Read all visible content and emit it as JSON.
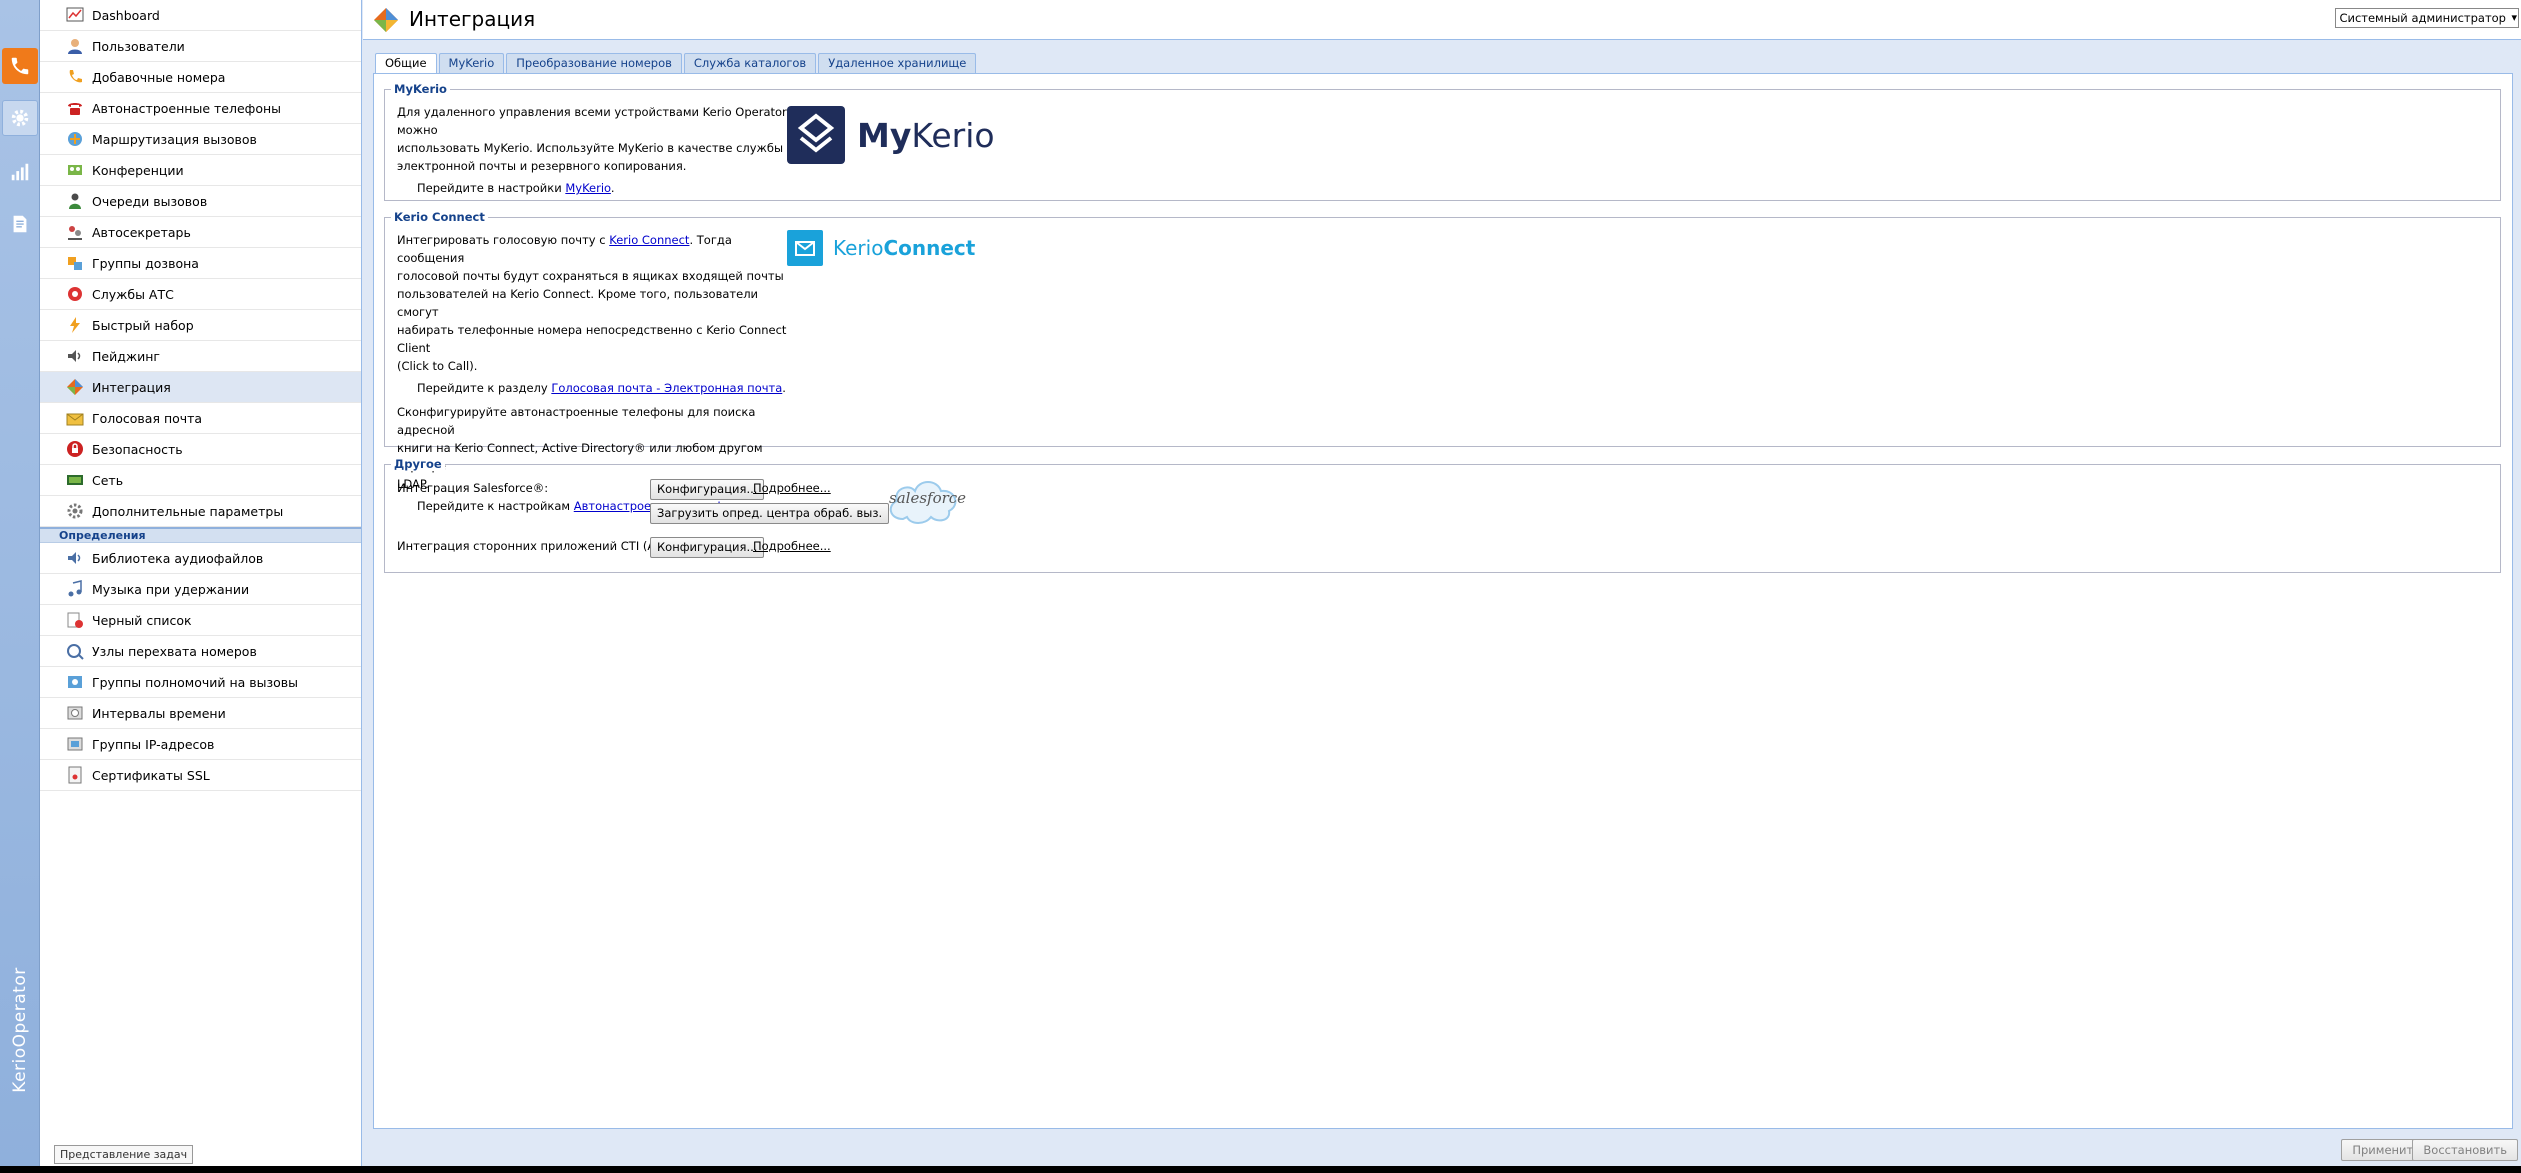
{
  "rail": {
    "brand": "KerioOperator",
    "items": [
      {
        "name": "phone-icon"
      },
      {
        "name": "gear-icon"
      },
      {
        "name": "bar-chart-icon"
      },
      {
        "name": "document-icon"
      }
    ]
  },
  "nav": {
    "items": [
      {
        "label": "Dashboard",
        "icon": "dashboard-icon"
      },
      {
        "label": "Пользователи",
        "icon": "user-icon"
      },
      {
        "label": "Добавочные номера",
        "icon": "handset-icon"
      },
      {
        "label": "Автонастроенные телефоны",
        "icon": "desk-phone-icon"
      },
      {
        "label": "Маршрутизация вызовов",
        "icon": "routing-icon"
      },
      {
        "label": "Конференции",
        "icon": "conference-icon"
      },
      {
        "label": "Очереди вызовов",
        "icon": "queue-icon"
      },
      {
        "label": "Автосекретарь",
        "icon": "auto-attendant-icon"
      },
      {
        "label": "Группы дозвона",
        "icon": "ring-group-icon"
      },
      {
        "label": "Службы АТС",
        "icon": "pbx-services-icon"
      },
      {
        "label": "Быстрый набор",
        "icon": "lightning-icon"
      },
      {
        "label": "Пейджинг",
        "icon": "speaker-icon"
      },
      {
        "label": "Интеграция",
        "icon": "integration-icon"
      },
      {
        "label": "Голосовая почта",
        "icon": "voicemail-icon"
      },
      {
        "label": "Безопасность",
        "icon": "security-icon"
      },
      {
        "label": "Сеть",
        "icon": "network-icon"
      },
      {
        "label": "Дополнительные параметры",
        "icon": "advanced-settings-icon"
      }
    ],
    "active_index": 12,
    "section_title": "Определения",
    "definitions": [
      {
        "label": "Библиотека аудиофайлов",
        "icon": "audio-library-icon"
      },
      {
        "label": "Музыка при удержании",
        "icon": "music-icon"
      },
      {
        "label": "Черный список",
        "icon": "blacklist-icon"
      },
      {
        "label": "Узлы перехвата номеров",
        "icon": "call-pickup-icon"
      },
      {
        "label": "Группы полномочий на вызовы",
        "icon": "call-permissions-icon"
      },
      {
        "label": "Интервалы времени",
        "icon": "time-intervals-icon"
      },
      {
        "label": "Группы IP-адресов",
        "icon": "ip-groups-icon"
      },
      {
        "label": "Сертификаты SSL",
        "icon": "certificate-icon"
      }
    ],
    "task_view_button": "Представление задач"
  },
  "header": {
    "title": "Интеграция",
    "user_select": "Системный администратор"
  },
  "tabs": [
    {
      "label": "Общие",
      "active": true
    },
    {
      "label": "MyKerio",
      "active": false
    },
    {
      "label": "Преобразование номеров",
      "active": false
    },
    {
      "label": "Служба каталогов",
      "active": false
    },
    {
      "label": "Удаленное хранилище",
      "active": false
    }
  ],
  "mykerio": {
    "title": "MyKerio",
    "description_lines": [
      "Для удаленного управления всеми устройствами Kerio Operator можно",
      "использовать MyKerio. Используйте MyKerio в качестве службы",
      "электронной почты и резервного копирования."
    ],
    "goto_prefix": "Перейдите в настройки ",
    "goto_link": "MyKerio",
    "goto_suffix": ".",
    "logo_bold": "My",
    "logo_light": "Kerio"
  },
  "connect": {
    "title": "Kerio Connect",
    "p1_prefix": "Интегрировать голосовую почту с ",
    "p1_link": "Kerio Connect",
    "p1_suffix": ". Тогда сообщения",
    "p1_lines": [
      "голосовой почты будут сохраняться в ящиках входящей почты",
      "пользователей на Kerio Connect. Кроме того, пользователи смогут",
      "набирать телефонные номера непосредственно с Kerio Connect Client",
      "(Click to Call)."
    ],
    "goto1_prefix": "Перейдите к разделу ",
    "goto1_link": "Голосовая почта - Электронная почта",
    "goto1_suffix": ".",
    "p2_lines": [
      "Сконфигурируйте автонастроенные телефоны для поиска адресной",
      "книги на Kerio Connect, Active Directory® или любом другом сервере",
      "LDAP."
    ],
    "goto2_prefix": "Перейдите к настройкам ",
    "goto2_link": "Автонастроенные телефоны",
    "goto2_suffix": ".",
    "logo_light": "Kerio",
    "logo_bold": "Connect"
  },
  "other": {
    "title": "Другое",
    "salesforce_label": "Интеграция Salesforce®:",
    "config_button": "Конфигурация...",
    "more_link": "Подробнее...",
    "download_button": "Загрузить опред. центра обраб. выз.",
    "salesforce_logo": "salesforce",
    "cti_label": "Интеграция сторонних приложений CTI (AMI):",
    "cti_config_button": "Конфигурация...",
    "cti_more_link": "Подробнее..."
  },
  "footer": {
    "apply": "Применить",
    "restore": "Восстановить"
  },
  "colors": {
    "accent_orange": "#f07a1a",
    "mykerio_navy": "#1f2d5a",
    "connect_blue": "#1aa2da",
    "link": "#0000cc",
    "group_title": "#15428b"
  }
}
